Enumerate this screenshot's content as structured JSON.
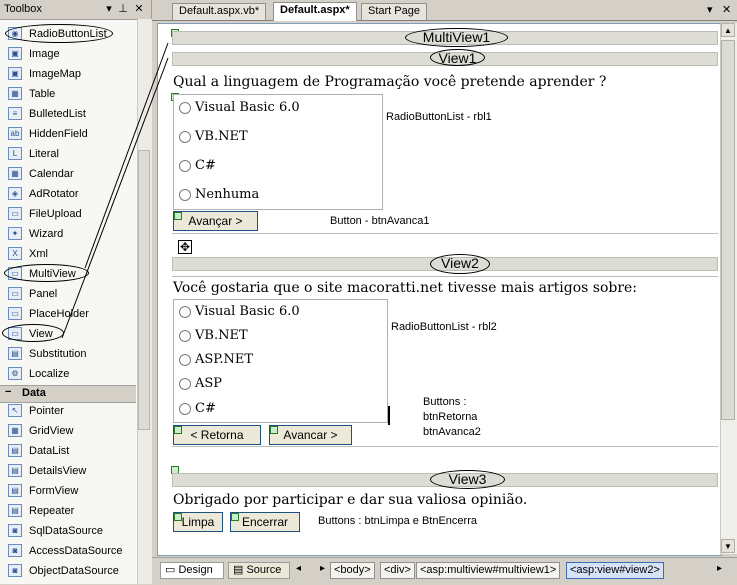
{
  "toolbox": {
    "title": "Toolbox",
    "controls": [
      "▾",
      "⊥",
      "✕"
    ],
    "items": [
      {
        "label": "RadioButtonList",
        "icon": "radio-list-icon",
        "glyph": "◉"
      },
      {
        "label": "Image",
        "icon": "image-icon",
        "glyph": "▣"
      },
      {
        "label": "ImageMap",
        "icon": "image-map-icon",
        "glyph": "▣"
      },
      {
        "label": "Table",
        "icon": "table-icon",
        "glyph": "▦"
      },
      {
        "label": "BulletedList",
        "icon": "bulleted-list-icon",
        "glyph": "≡"
      },
      {
        "label": "HiddenField",
        "icon": "hidden-field-icon",
        "glyph": "ab"
      },
      {
        "label": "Literal",
        "icon": "literal-icon",
        "glyph": "L"
      },
      {
        "label": "Calendar",
        "icon": "calendar-icon",
        "glyph": "▦"
      },
      {
        "label": "AdRotator",
        "icon": "ad-rotator-icon",
        "glyph": "◈"
      },
      {
        "label": "FileUpload",
        "icon": "file-upload-icon",
        "glyph": "▭"
      },
      {
        "label": "Wizard",
        "icon": "wizard-icon",
        "glyph": "✦"
      },
      {
        "label": "Xml",
        "icon": "xml-icon",
        "glyph": "X"
      },
      {
        "label": "MultiView",
        "icon": "multiview-icon",
        "glyph": "▭"
      },
      {
        "label": "Panel",
        "icon": "panel-icon",
        "glyph": "▭"
      },
      {
        "label": "PlaceHolder",
        "icon": "placeholder-icon",
        "glyph": "▭"
      },
      {
        "label": "View",
        "icon": "view-icon",
        "glyph": "▭"
      },
      {
        "label": "Substitution",
        "icon": "substitution-icon",
        "glyph": "▤"
      },
      {
        "label": "Localize",
        "icon": "localize-icon",
        "glyph": "⚙"
      }
    ],
    "data_group": {
      "sign": "−",
      "label": "Data"
    },
    "data_items": [
      {
        "label": "Pointer",
        "icon": "pointer-icon",
        "glyph": "↖"
      },
      {
        "label": "GridView",
        "icon": "gridview-icon",
        "glyph": "▦"
      },
      {
        "label": "DataList",
        "icon": "datalist-icon",
        "glyph": "▤"
      },
      {
        "label": "DetailsView",
        "icon": "detailsview-icon",
        "glyph": "▤"
      },
      {
        "label": "FormView",
        "icon": "formview-icon",
        "glyph": "▤"
      },
      {
        "label": "Repeater",
        "icon": "repeater-icon",
        "glyph": "▤"
      },
      {
        "label": "SqlDataSource",
        "icon": "sql-datasource-icon",
        "glyph": "◙"
      },
      {
        "label": "AccessDataSource",
        "icon": "access-datasource-icon",
        "glyph": "◙"
      },
      {
        "label": "ObjectDataSource",
        "icon": "object-datasource-icon",
        "glyph": "◙"
      }
    ]
  },
  "tabs": [
    {
      "label": "Default.aspx.vb*"
    },
    {
      "label": "Default.aspx*"
    },
    {
      "label": "Start Page"
    }
  ],
  "tab_controls": {
    "dropdown": "▾",
    "close": "✕"
  },
  "designer": {
    "multiview_label": "MultiView1",
    "view1": {
      "label": "View1",
      "question": "Qual a linguagem de Programação você pretende aprender ?",
      "options": [
        "Visual Basic 6.0",
        "VB.NET",
        "C#",
        "Nenhuma"
      ],
      "rbl_note": "RadioButtonList - rbl1",
      "button": "Avançar >",
      "button_note": "Button - btnAvanca1"
    },
    "view2": {
      "label": "View2",
      "question": "Você gostaria que o site macoratti.net tivesse mais artigos sobre:",
      "options": [
        "Visual Basic 6.0",
        "VB.NET",
        "ASP.NET",
        "ASP",
        "C#"
      ],
      "rbl_note": "RadioButtonList - rbl2",
      "button_back": "< Retorna",
      "button_next": "Avancar >",
      "buttons_note": [
        "Buttons :",
        "btnRetorna",
        "btnAvanca2"
      ]
    },
    "view3": {
      "label": "View3",
      "message": "Obrigado por participar e dar sua valiosa opinião.",
      "button_clear": "Limpa",
      "button_end": "Encerrar",
      "buttons_note": "Buttons :  btnLimpa e BtnEncerra"
    }
  },
  "bottom": {
    "design": "Design",
    "source": "Source",
    "breadcrumbs": [
      "<body>",
      "<div>",
      "<asp:multiview#multiview1>",
      "<asp:view#view2>"
    ]
  }
}
